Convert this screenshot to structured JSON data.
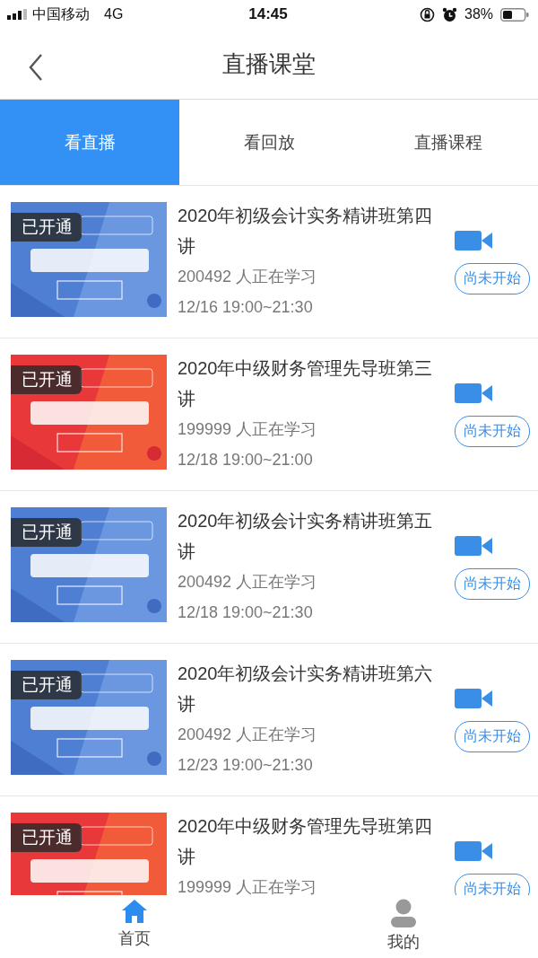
{
  "status_bar": {
    "carrier": "中国移动",
    "network": "4G",
    "time": "14:45",
    "battery": "38%"
  },
  "header": {
    "title": "直播课堂"
  },
  "tabs": [
    {
      "label": "看直播",
      "selected": true
    },
    {
      "label": "看回放",
      "selected": false
    },
    {
      "label": "直播课程",
      "selected": false
    }
  ],
  "courses": [
    {
      "cover": {
        "kind": "blue"
      },
      "badge": "已开通",
      "title": "2020年初级会计实务精讲班第四讲",
      "learners": "200492 人正在学习",
      "time": "12/16 19:00~21:30",
      "button": "尚未开始"
    },
    {
      "cover": {
        "kind": "red"
      },
      "badge": "已开通",
      "title": "2020年中级财务管理先导班第三讲",
      "learners": "199999 人正在学习",
      "time": "12/18 19:00~21:00",
      "button": "尚未开始"
    },
    {
      "cover": {
        "kind": "blue"
      },
      "badge": "已开通",
      "title": "2020年初级会计实务精讲班第五讲",
      "learners": "200492 人正在学习",
      "time": "12/18 19:00~21:30",
      "button": "尚未开始"
    },
    {
      "cover": {
        "kind": "blue"
      },
      "badge": "已开通",
      "title": "2020年初级会计实务精讲班第六讲",
      "learners": "200492 人正在学习",
      "time": "12/23 19:00~21:30",
      "button": "尚未开始"
    },
    {
      "cover": {
        "kind": "red"
      },
      "badge": "已开通",
      "title": "2020年中级财务管理先导班第四讲",
      "learners": "199999 人正在学习",
      "button": "尚未开始"
    }
  ],
  "bottom_nav": [
    {
      "label": "首页",
      "selected": true
    },
    {
      "label": "我的",
      "selected": false
    }
  ]
}
